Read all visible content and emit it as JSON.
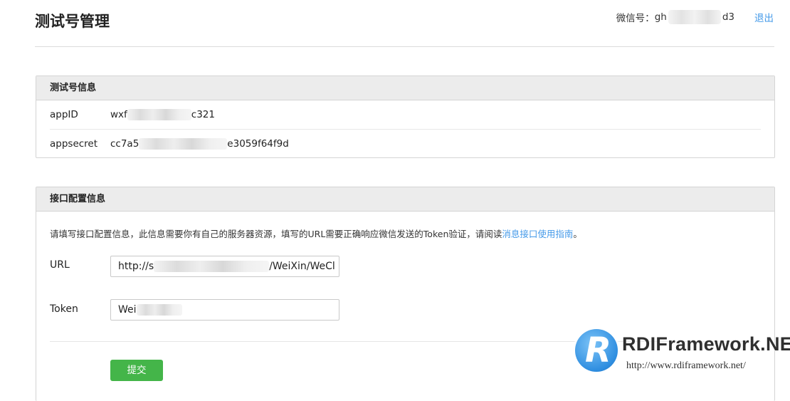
{
  "header": {
    "title": "测试号管理",
    "account_label": "微信号：",
    "account_prefix": "gh",
    "account_suffix": "d3",
    "logout": "退出"
  },
  "test_account": {
    "section_title": "测试号信息",
    "rows": [
      {
        "label": "appID",
        "value_prefix": "wxf",
        "value_suffix": "c321"
      },
      {
        "label": "appsecret",
        "value_prefix": "cc7a5",
        "value_suffix": "e3059f64f9d"
      }
    ]
  },
  "config": {
    "section_title": "接口配置信息",
    "description": "请填写接口配置信息，此信息需要你有自己的服务器资源，填写的URL需要正确响应微信发送的Token验证，请阅读",
    "guide_link": "消息接口使用指南",
    "description_end": "。",
    "url_label": "URL",
    "url_prefix": "http://s",
    "url_suffix": "/WeiXin/WeCl",
    "token_label": "Token",
    "token_value": "Wei",
    "submit": "提交"
  },
  "watermark": {
    "letter": "R",
    "title": "RDIFramework.NET",
    "url": "http://www.rdiframework.net/"
  }
}
